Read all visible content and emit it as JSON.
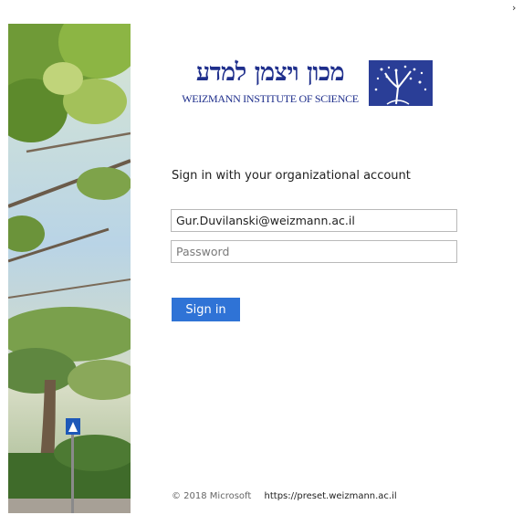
{
  "window": {
    "close_glyph": "›"
  },
  "logo": {
    "hebrew": "מכון ויצמן למדע",
    "english": "WEIZMANN INSTITUTE OF SCIENCE",
    "color": "#1f2f8c"
  },
  "login": {
    "heading": "Sign in with your organizational account",
    "username_value": "Gur.Duvilanski@weizmann.ac.il",
    "password_placeholder": "Password",
    "signin_label": "Sign in"
  },
  "footer": {
    "copyright": "© 2018 Microsoft",
    "link": "https://preset.weizmann.ac.il"
  },
  "colors": {
    "accent": "#2f73d6",
    "border": "#b9b9b9",
    "emblem": "#2a3e97"
  }
}
